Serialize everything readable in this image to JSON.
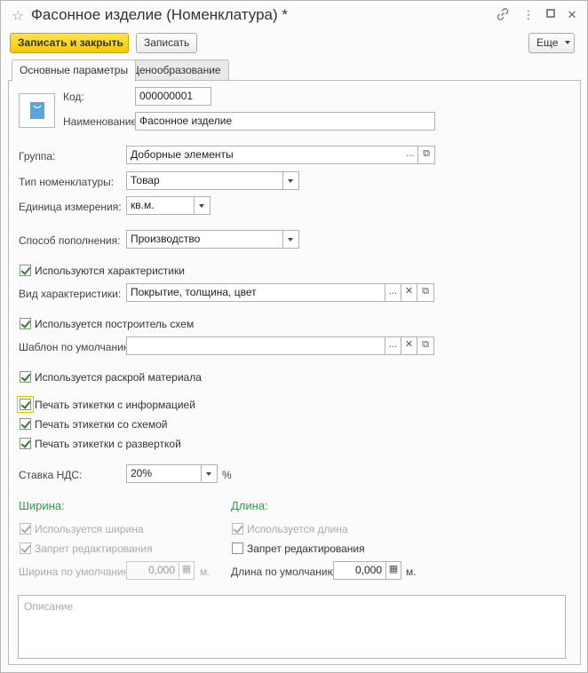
{
  "window": {
    "title": "Фасонное изделие (Номенклатура) *"
  },
  "toolbar": {
    "save_close_label": "Записать и закрыть",
    "save_label": "Записать",
    "more_label": "Еще"
  },
  "tabs": [
    {
      "label": "Основные параметры",
      "active": true
    },
    {
      "label": "Ценообразование",
      "active": false
    }
  ],
  "fields": {
    "code_label": "Код:",
    "code_value": "000000001",
    "name_label": "Наименование:",
    "name_value": "Фасонное изделие",
    "group_label": "Группа:",
    "group_value": "Доборные элементы",
    "type_label": "Тип номенклатуры:",
    "type_value": "Товар",
    "unit_label": "Единица измерения:",
    "unit_value": "кв.м.",
    "supply_label": "Способ пополнения:",
    "supply_value": "Производство",
    "char_kind_label": "Вид характеристики:",
    "char_kind_value": "Покрытие, толщина, цвет",
    "template_label": "Шаблон по умолчанию:",
    "template_value": "",
    "vat_label": "Ставка НДС:",
    "vat_value": "20%",
    "vat_unit": "%"
  },
  "checkboxes": {
    "use_characteristics": {
      "label": "Используются характеристики",
      "checked": true
    },
    "use_scheme_builder": {
      "label": "Используется построитель схем",
      "checked": true
    },
    "use_material_cutting": {
      "label": "Используется раскрой материала",
      "checked": true
    },
    "print_label_info": {
      "label": "Печать этикетки с информацией",
      "checked": true
    },
    "print_label_scheme": {
      "label": "Печать этикетки со схемой",
      "checked": true
    },
    "print_label_unfold": {
      "label": "Печать этикетки с разверткой",
      "checked": true
    }
  },
  "width_section": {
    "title": "Ширина:",
    "used_label": "Используется ширина",
    "edit_lock_label": "Запрет редактирования",
    "default_label": "Ширина по умолчанию:",
    "default_value": "0,000",
    "unit": "м."
  },
  "length_section": {
    "title": "Длина:",
    "used_label": "Используется длина",
    "edit_lock_label": "Запрет редактирования",
    "default_label": "Длина по умолчанию:",
    "default_value": "0,000",
    "unit": "м."
  },
  "description": {
    "placeholder": "Описание"
  },
  "icons": {
    "star": "star-icon",
    "link": "link-icon",
    "menu": "more-vertical-icon",
    "maximize": "maximize-icon",
    "close": "close-icon",
    "item_image": "bag-icon",
    "ellipsis": "ellipsis-icon",
    "clear": "clear-icon",
    "open": "open-icon",
    "calendar": "calculator-icon"
  },
  "colors": {
    "primary_button": "#f5c800",
    "section_title": "#2f9a4e",
    "checkmark": "#2f7d2f"
  }
}
